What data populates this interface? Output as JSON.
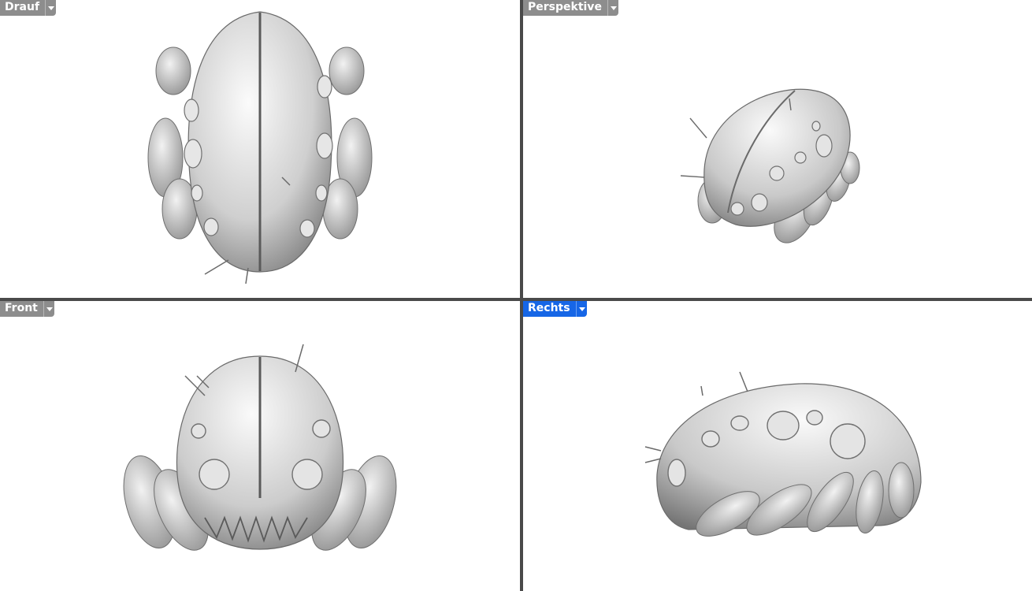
{
  "viewports": {
    "top": {
      "label": "Drauf",
      "active": false
    },
    "perspective": {
      "label": "Perspektive",
      "active": false
    },
    "front": {
      "label": "Front",
      "active": false
    },
    "right": {
      "label": "Rechts",
      "active": true
    }
  },
  "colors": {
    "background": "#ffffff",
    "splitter": "#4a4a4a",
    "tab_inactive": "#8d8d8d",
    "tab_active": "#1666e6"
  }
}
